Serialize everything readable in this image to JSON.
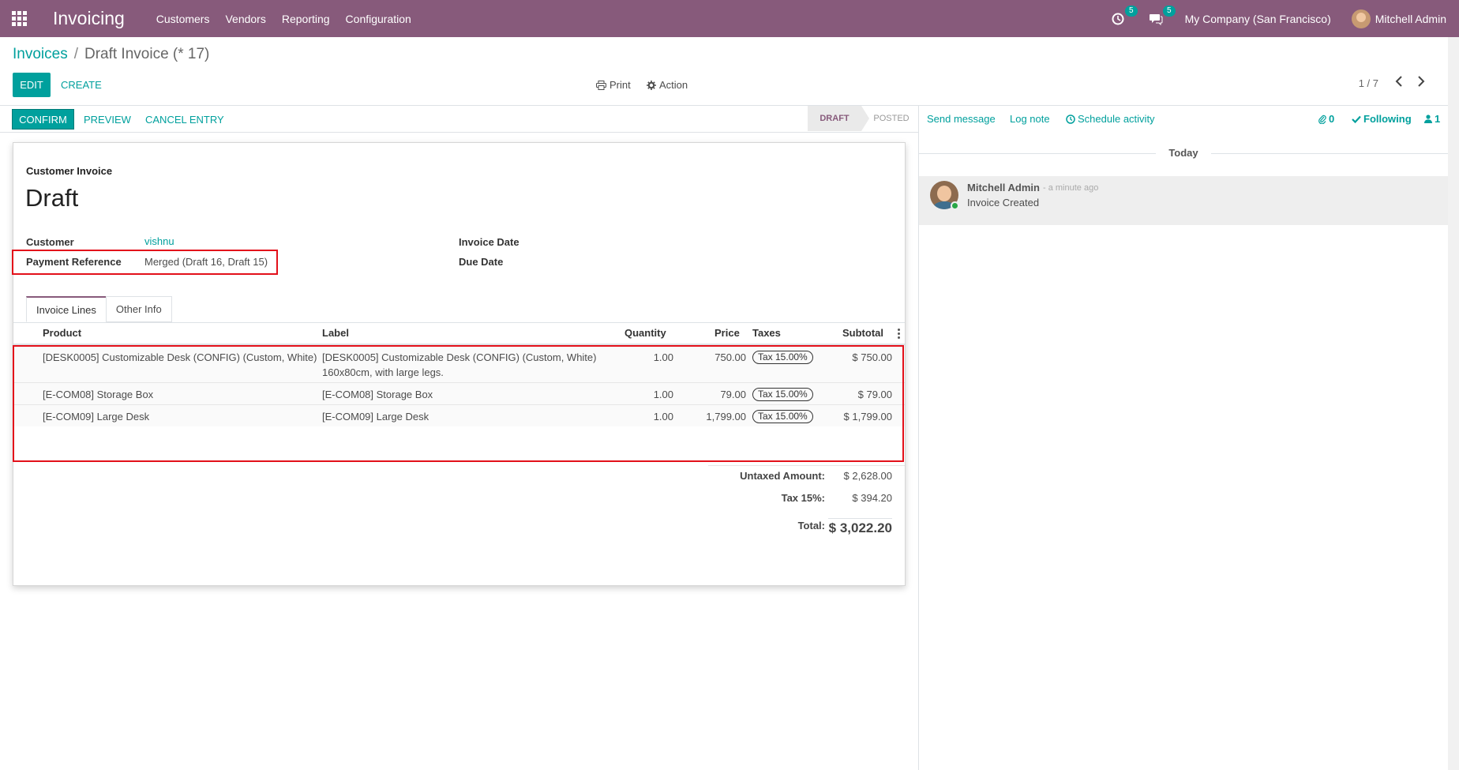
{
  "navbar": {
    "app_name": "Invoicing",
    "menu": [
      "Customers",
      "Vendors",
      "Reporting",
      "Configuration"
    ],
    "activity_count": "5",
    "messages_count": "5",
    "company": "My Company (San Francisco)",
    "user": "Mitchell Admin",
    "bg_color": "#875a7b"
  },
  "control_panel": {
    "breadcrumb_parent": "Invoices",
    "breadcrumb_separator": "/",
    "breadcrumb_current": "Draft Invoice (* 17)",
    "edit_label": "EDIT",
    "create_label": "CREATE",
    "print_label": "Print",
    "action_label": "Action",
    "pager": "1 / 7"
  },
  "statusbar": {
    "confirm_label": "CONFIRM",
    "preview_label": "PREVIEW",
    "cancel_label": "CANCEL ENTRY",
    "stages": [
      "DRAFT",
      "POSTED"
    ],
    "active_stage": "DRAFT"
  },
  "invoice": {
    "type": "Customer Invoice",
    "title": "Draft",
    "customer_label": "Customer",
    "customer_value": "vishnu",
    "payment_ref_label": "Payment Reference",
    "payment_ref_value": "Merged (Draft 16, Draft 15)",
    "invoice_date_label": "Invoice Date",
    "due_date_label": "Due Date",
    "tabs": [
      "Invoice Lines",
      "Other Info"
    ],
    "columns": [
      "Product",
      "Label",
      "Quantity",
      "Price",
      "Taxes",
      "Subtotal"
    ],
    "lines": [
      {
        "product": "[DESK0005] Customizable Desk (CONFIG) (Custom, White)",
        "label_1": "[DESK0005] Customizable Desk (CONFIG) (Custom, White)",
        "label_2": "160x80cm, with large legs.",
        "quantity": "1.00",
        "price": "750.00",
        "tax": "Tax 15.00%",
        "subtotal": "$ 750.00"
      },
      {
        "product": "[E-COM08] Storage Box",
        "label_1": "[E-COM08] Storage Box",
        "label_2": "",
        "quantity": "1.00",
        "price": "79.00",
        "tax": "Tax 15.00%",
        "subtotal": "$ 79.00"
      },
      {
        "product": "[E-COM09] Large Desk",
        "label_1": "[E-COM09] Large Desk",
        "label_2": "",
        "quantity": "1.00",
        "price": "1,799.00",
        "tax": "Tax 15.00%",
        "subtotal": "$ 1,799.00"
      }
    ],
    "totals": {
      "untaxed_label": "Untaxed Amount:",
      "untaxed_value": "$ 2,628.00",
      "tax_label": "Tax 15%:",
      "tax_value": "$ 394.20",
      "total_label": "Total:",
      "total_value": "$ 3,022.20"
    }
  },
  "chatter": {
    "send_message": "Send message",
    "log_note": "Log note",
    "schedule_activity": "Schedule activity",
    "attachments": "0",
    "following": "Following",
    "followers": "1",
    "date_separator": "Today",
    "message": {
      "author": "Mitchell Admin",
      "time": "- a minute ago",
      "body": "Invoice Created"
    }
  }
}
